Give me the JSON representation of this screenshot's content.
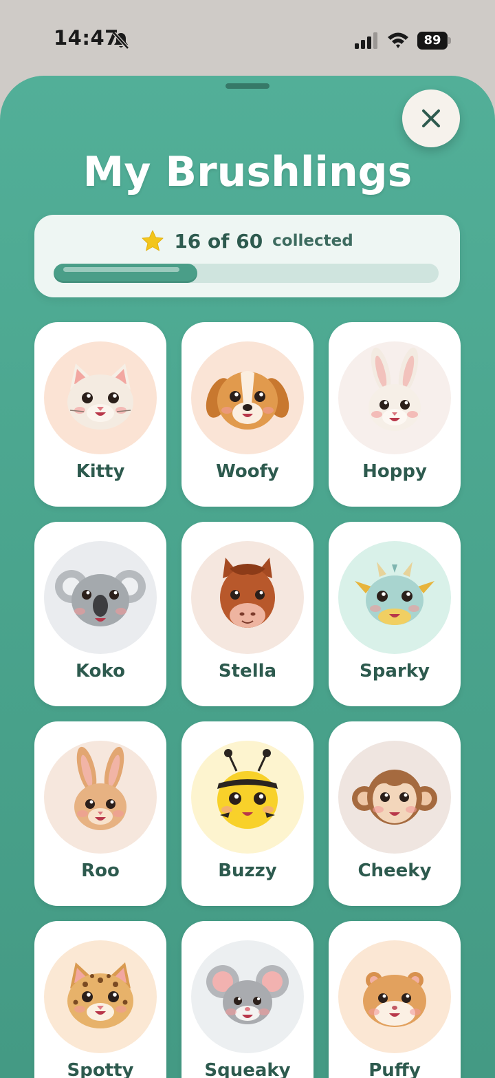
{
  "status_bar": {
    "time": "14:47",
    "battery": "89",
    "icons": [
      "bell-slash-icon",
      "signal-icon",
      "wifi-icon",
      "battery-icon"
    ]
  },
  "sheet": {
    "title": "My Brushlings",
    "close_icon": "close-icon"
  },
  "progress": {
    "icon": "star-icon",
    "count_text": "16 of 60",
    "suffix": "collected",
    "collected": 16,
    "total": 60
  },
  "colors": {
    "sheet": "#4ea894",
    "card": "#ffffff",
    "name_text": "#2d5a4e",
    "star": "#f2c51c"
  },
  "brushlings": [
    {
      "name": "Kitty",
      "animal": "cat",
      "bg": "#fbe3d4",
      "color": "#f4ebe1",
      "ear": "#f6efe6",
      "inner": "#f2a7a1",
      "snout": "#fbf5ee"
    },
    {
      "name": "Woofy",
      "animal": "dog",
      "bg": "#fae4d6",
      "color": "#e19a4d",
      "ear": "#c8782f",
      "inner": "#c8782f",
      "snout": "#fbeee0"
    },
    {
      "name": "Hoppy",
      "animal": "bunny",
      "bg": "#f7efec",
      "color": "#f6efe7",
      "ear": "#f3ebe2",
      "inner": "#f2c2bc",
      "snout": "#fdf8f3"
    },
    {
      "name": "Koko",
      "animal": "koala",
      "bg": "#eaecef",
      "color": "#a4a9ad",
      "ear": "#b6babe",
      "inner": "#eef0f2",
      "snout": "#3d3d40"
    },
    {
      "name": "Stella",
      "animal": "horse",
      "bg": "#f5e7df",
      "color": "#b8582b",
      "ear": "#a54a22",
      "inner": "#e8a27a",
      "snout": "#eeb4a0"
    },
    {
      "name": "Sparky",
      "animal": "dragon",
      "bg": "#d9f1e9",
      "color": "#a8d4cf",
      "ear": "#e7d39a",
      "inner": "#f1cf62",
      "snout": "#f1cf62"
    },
    {
      "name": "Roo",
      "animal": "kangaroo",
      "bg": "#f6e7dd",
      "color": "#e7b282",
      "ear": "#e2a671",
      "inner": "#f1b4a6",
      "snout": "#f8e2cc"
    },
    {
      "name": "Buzzy",
      "animal": "bee",
      "bg": "#fdf4cf",
      "color": "#f8d12a",
      "ear": "#2a2420",
      "inner": "#2a2420",
      "snout": "#f8d12a"
    },
    {
      "name": "Cheeky",
      "animal": "monkey",
      "bg": "#efe5e0",
      "color": "#a56a3f",
      "ear": "#a56a3f",
      "inner": "#efc8a7",
      "snout": "#f3d6bb"
    },
    {
      "name": "Spotty",
      "animal": "leopard",
      "bg": "#fbe8d4",
      "color": "#e7b26a",
      "ear": "#d99a50",
      "inner": "#f2a7a1",
      "snout": "#fbf1e2"
    },
    {
      "name": "Squeaky",
      "animal": "mouse",
      "bg": "#eceff1",
      "color": "#a9abaf",
      "ear": "#b4b6ba",
      "inner": "#f2b2b0",
      "snout": "#f4f3f1"
    },
    {
      "name": "Puffy",
      "animal": "hamster",
      "bg": "#fbe7d4",
      "color": "#e2a15e",
      "ear": "#d8914e",
      "inner": "#f2b0a2",
      "snout": "#fbf0e4"
    }
  ]
}
